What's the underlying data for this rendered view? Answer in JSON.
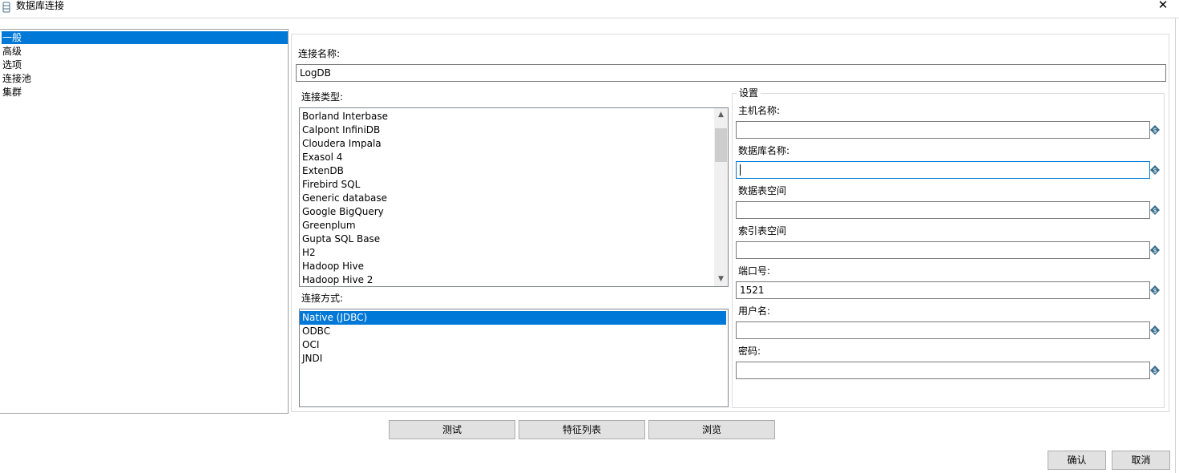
{
  "window": {
    "title": "数据库连接",
    "close_glyph": "✕"
  },
  "nav": {
    "items": [
      "一般",
      "高级",
      "选项",
      "连接池",
      "集群"
    ],
    "selected": 0
  },
  "connection_name": {
    "label": "连接名称:",
    "value": "LogDB"
  },
  "connection_type": {
    "label": "连接类型:",
    "items": [
      "Borland Interbase",
      "Calpont InfiniDB",
      "Cloudera Impala",
      "Exasol 4",
      "ExtenDB",
      "Firebird SQL",
      "Generic database",
      "Google BigQuery",
      "Greenplum",
      "Gupta SQL Base",
      "H2",
      "Hadoop Hive",
      "Hadoop Hive 2"
    ]
  },
  "access": {
    "label": "连接方式:",
    "items": [
      "Native (JDBC)",
      "ODBC",
      "OCI",
      "JNDI"
    ],
    "selected": 0
  },
  "settings": {
    "title": "设置",
    "fields": [
      {
        "label": "主机名称:",
        "value": ""
      },
      {
        "label": "数据库名称:",
        "value": ""
      },
      {
        "label": "数据表空间",
        "value": ""
      },
      {
        "label": "索引表空间",
        "value": ""
      },
      {
        "label": "端口号:",
        "value": "1521"
      },
      {
        "label": "用户名:",
        "value": ""
      },
      {
        "label": "密码:",
        "value": ""
      }
    ]
  },
  "buttons": {
    "test": "测试",
    "features": "特征列表",
    "explore": "浏览",
    "ok": "确认",
    "cancel": "取消"
  },
  "colors": {
    "selection": "#0078d7",
    "button_face": "#e1e1e1",
    "variable_icon": "#3a6f8f"
  }
}
